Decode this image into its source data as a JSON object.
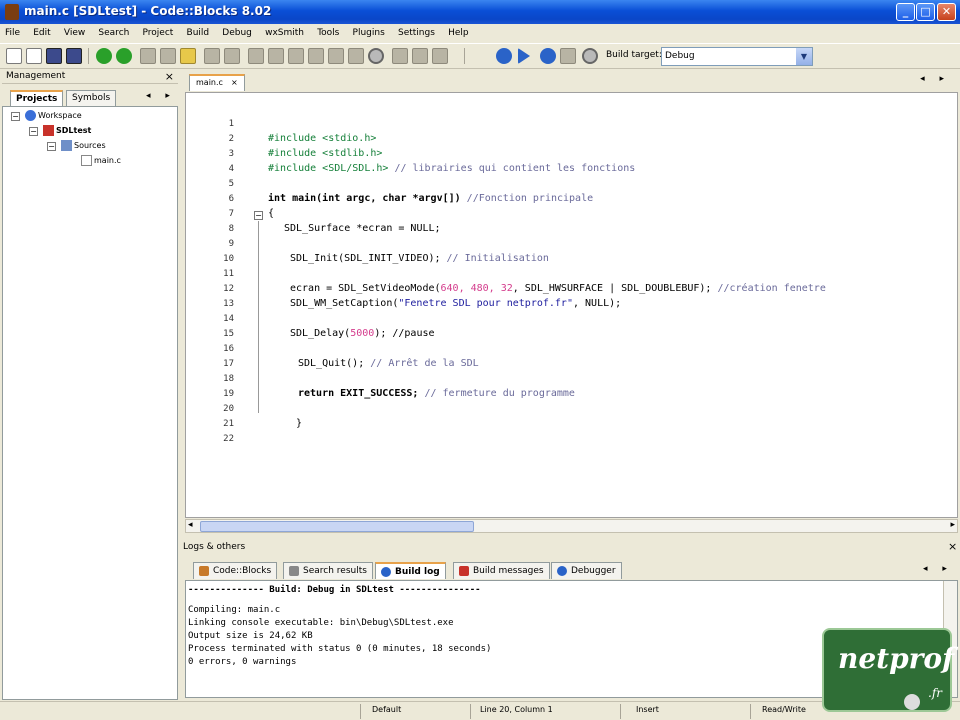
{
  "window": {
    "title": "main.c [SDLtest] - Code::Blocks 8.02",
    "min": "_",
    "max": "□",
    "close": "✕"
  },
  "menu": [
    "File",
    "Edit",
    "View",
    "Search",
    "Project",
    "Build",
    "Debug",
    "wxSmith",
    "Tools",
    "Plugins",
    "Settings",
    "Help"
  ],
  "toolbar": {
    "build_target_label": "Build target:",
    "build_target_value": "Debug"
  },
  "management": {
    "title": "Management",
    "close": "×",
    "tabs": [
      "Projects",
      "Symbols"
    ],
    "tab_arrows": "◂ ▸",
    "tree": {
      "workspace": "Workspace",
      "project": "SDLtest",
      "folder": "Sources",
      "file": "main.c"
    }
  },
  "editor": {
    "tab_label": "main.c",
    "tab_close": "×",
    "arrows": "◂ ▸",
    "line_numbers": [
      "1",
      "2",
      "3",
      "4",
      "5",
      "6",
      "7",
      "8",
      "9",
      "10",
      "11",
      "12",
      "13",
      "14",
      "15",
      "16",
      "17",
      "18",
      "19",
      "20",
      "21",
      "22"
    ],
    "lines": {
      "l2": "#include <stdio.h>",
      "l3": "#include <stdlib.h>",
      "l4a": "#include <SDL/SDL.h>",
      "l4b": " // librairies qui contient les fonctions",
      "l6a": "int main(int argc, char *argv[])",
      "l6b": " //Fonction principale",
      "l7": "{",
      "l8": "SDL_Surface *ecran = NULL;",
      "l10a": "SDL_Init(SDL_INIT_VIDEO);",
      "l10b": " // Initialisation",
      "l12a": "ecran = SDL_SetVideoMode(",
      "l12b": "640, 480, 32",
      "l12c": ", SDL_HWSURFACE | SDL_DOUBLEBUF);",
      "l12d": " //création fenetre",
      "l13a": "SDL_WM_SetCaption(",
      "l13b": "\"Fenetre SDL pour netprof.fr\"",
      "l13c": ", NULL);",
      "l15a": "SDL_Delay(",
      "l15b": "5000",
      "l15c": "); //pause",
      "l17a": "SDL_Quit();",
      "l17b": " // Arrêt de la SDL",
      "l19a": "return EXIT_SUCCESS;",
      "l19b": " // fermeture du programme",
      "l21": "}"
    },
    "fold_minus": "−"
  },
  "logs": {
    "title": "Logs & others",
    "close": "×",
    "arrows": "◂ ▸",
    "tabs": [
      "Code::Blocks",
      "Search results",
      "Build log",
      "Build messages",
      "Debugger"
    ],
    "lines": [
      "-------------- Build: Debug in SDLtest ---------------",
      "Compiling: main.c",
      "Linking console executable: bin\\Debug\\SDLtest.exe",
      "Output size is 24,62 KB",
      "Process terminated with status 0 (0 minutes, 18 seconds)",
      "0 errors, 0 warnings"
    ]
  },
  "status": {
    "encoding": "Default",
    "position": "Line 20, Column 1",
    "mode": "Insert",
    "access": "Read/Write"
  },
  "logo": {
    "text": "netprof",
    "sub": ".fr"
  },
  "colors": {
    "titlebar": "#0a4fd6",
    "preprocessor": "#16803a",
    "comment": "#6a6a9a",
    "number": "#d43c8c",
    "string": "#1d1d9e"
  }
}
